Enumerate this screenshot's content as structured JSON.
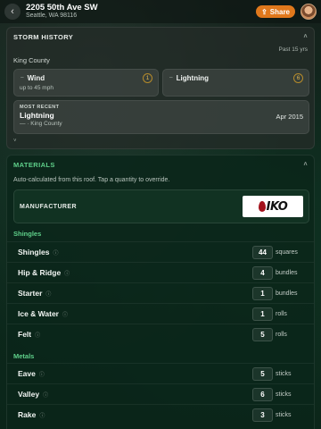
{
  "header": {
    "address_line1": "2205 50th Ave SW",
    "address_line2": "Seattle, WA 98116",
    "share_label": "Share",
    "share_icon": "share-icon",
    "back_icon": "chevron-left-icon",
    "accent_color": "#e0781c"
  },
  "storm_history": {
    "title": "STORM HISTORY",
    "period": "Past 15 yrs",
    "county": "King County",
    "hazards": [
      {
        "label": "Wind",
        "count": "1",
        "detail": "up to 45 mph"
      },
      {
        "label": "Lightning",
        "count": "6",
        "detail": ""
      }
    ],
    "most_recent": {
      "caption": "MOST RECENT",
      "event": "Lightning",
      "date": "Apr 2015",
      "location": "— · King County"
    }
  },
  "materials": {
    "title": "MATERIALS",
    "description": "Auto-calculated from this roof. Tap a quantity to override.",
    "manufacturer_label": "MANUFACTURER",
    "manufacturer_logo_text": "IKO",
    "accent_color": "#5fd08a",
    "groups": [
      {
        "title": "Shingles",
        "items": [
          {
            "name": "Shingles",
            "qty": "44",
            "unit": "squares"
          },
          {
            "name": "Hip & Ridge",
            "qty": "4",
            "unit": "bundles"
          },
          {
            "name": "Starter",
            "qty": "1",
            "unit": "bundles"
          },
          {
            "name": "Ice & Water",
            "qty": "1",
            "unit": "rolls"
          },
          {
            "name": "Felt",
            "qty": "5",
            "unit": "rolls"
          }
        ]
      },
      {
        "title": "Metals",
        "items": [
          {
            "name": "Eave",
            "qty": "5",
            "unit": "sticks"
          },
          {
            "name": "Valley",
            "qty": "6",
            "unit": "sticks"
          },
          {
            "name": "Rake",
            "qty": "3",
            "unit": "sticks"
          }
        ]
      }
    ]
  }
}
